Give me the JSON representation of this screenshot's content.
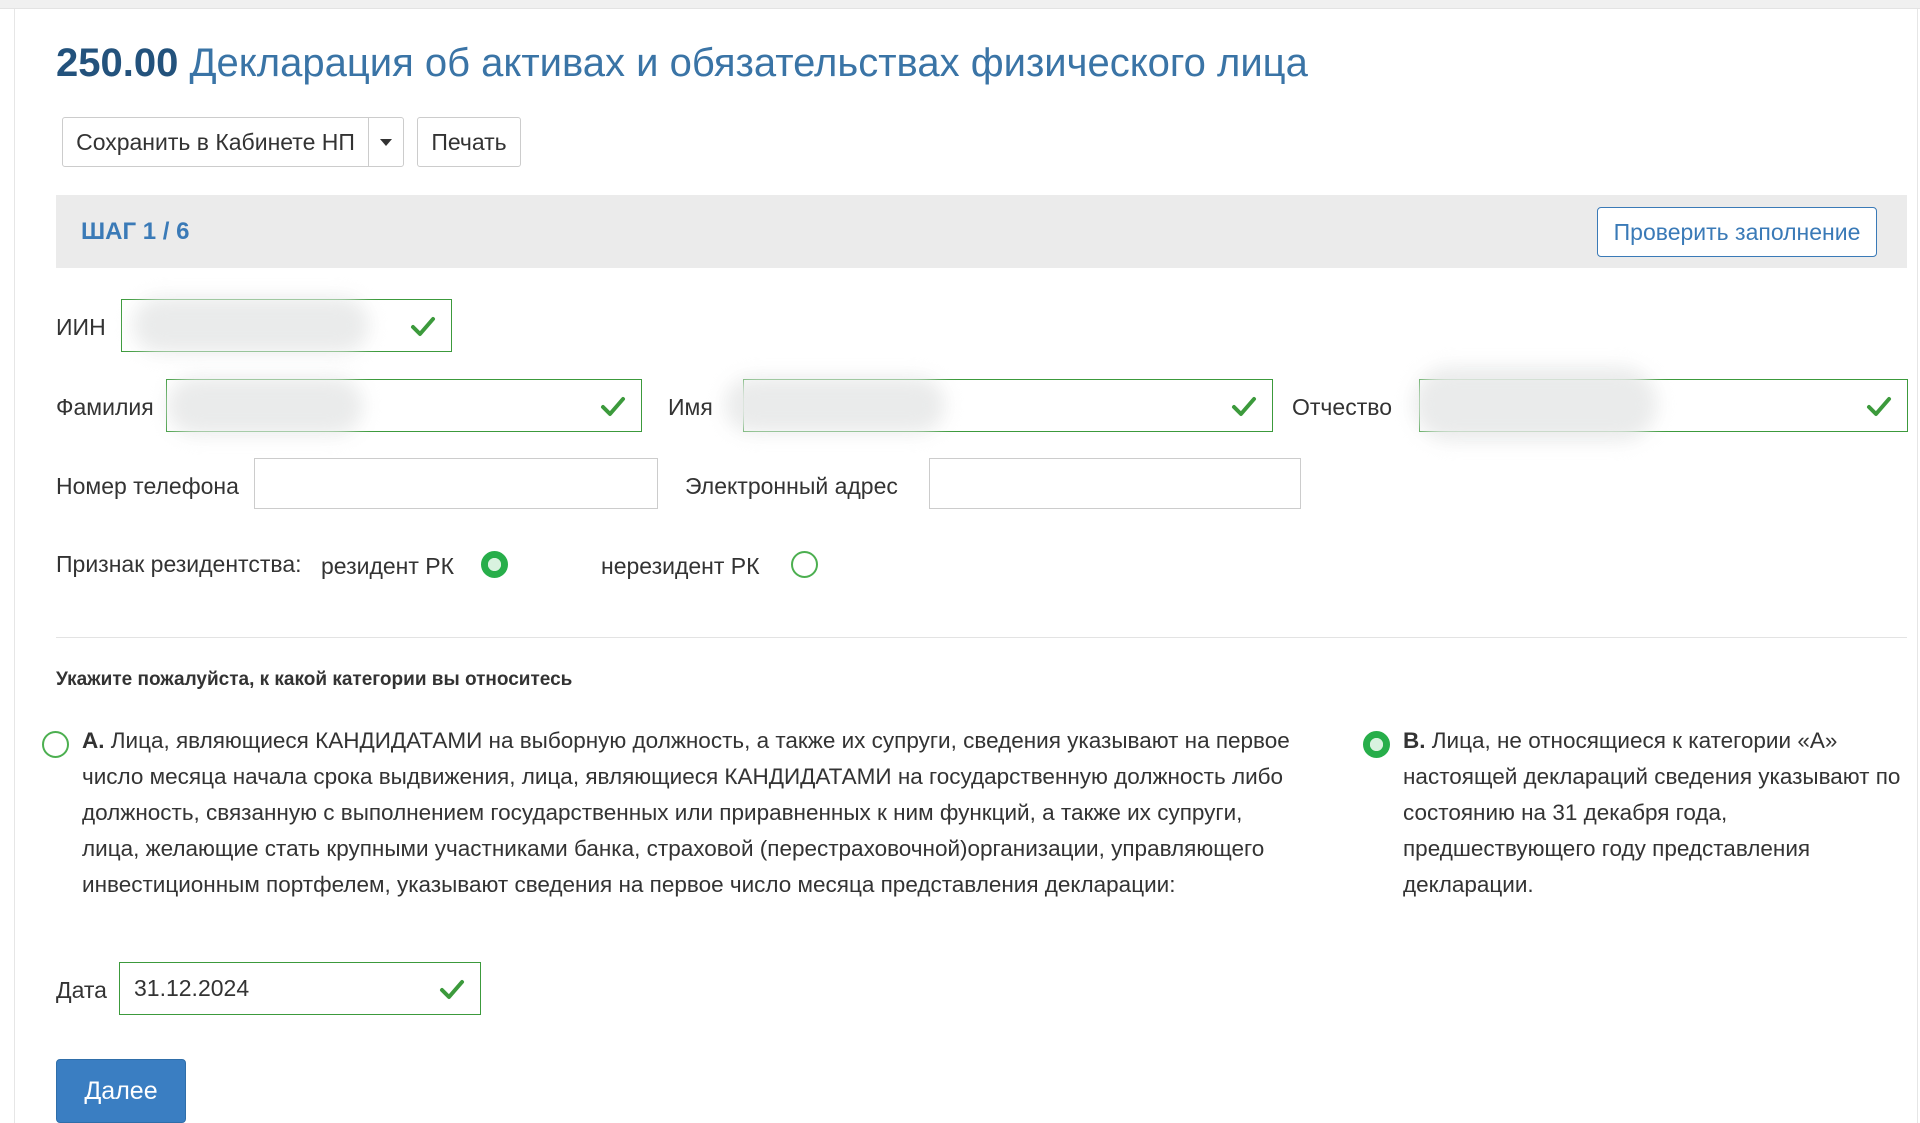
{
  "header": {
    "code": "250.00",
    "title": "Декларация об активах и обязательствах физического лица"
  },
  "toolbar": {
    "save_label": "Сохранить в Кабинете НП",
    "print_label": "Печать"
  },
  "step": {
    "label": "ШАГ 1 / 6",
    "check_button": "Проверить заполнение"
  },
  "fields": {
    "iin_label": "ИИН",
    "lastname_label": "Фамилия",
    "firstname_label": "Имя",
    "patronymic_label": "Отчество",
    "phone_label": "Номер телефона",
    "email_label": "Электронный адрес",
    "phone_value": "",
    "email_value": ""
  },
  "residency": {
    "label": "Признак резидентства:",
    "options": [
      {
        "label": "резидент РК",
        "selected": true
      },
      {
        "label": "нерезидент РК",
        "selected": false
      }
    ]
  },
  "category": {
    "question": "Укажите пожалуйста, к какой категории вы относитесь",
    "options": [
      {
        "letter": "А.",
        "text": "Лица, являющиеся КАНДИДАТАМИ на выборную должность, а также их супруги, сведения указывают на первое число месяца начала срока выдвижения, лица, являющиеся КАНДИДАТАМИ на государственную должность либо должность, связанную с выполнением государственных или приравненных к ним функций, а также их супруги, лица, желающие стать крупными участниками банка, страховой (перестраховочной)организации, управляющего инвестиционным портфелем, указывают сведения на первое число месяца представления декларации:",
        "selected": false
      },
      {
        "letter": "В.",
        "text": "Лица, не относящиеся к категории «А» настоящей деклараций сведения указывают по состоянию на 31 декабря года, предшествующего году представления декларации.",
        "selected": true
      }
    ]
  },
  "date": {
    "label": "Дата",
    "value": "31.12.2024"
  },
  "next_button": "Далее",
  "colors": {
    "accent": "#3a7ab7",
    "valid": "#3c9a3c",
    "radio_on": "#27ae4a",
    "primary_button": "#3a7ec2"
  }
}
